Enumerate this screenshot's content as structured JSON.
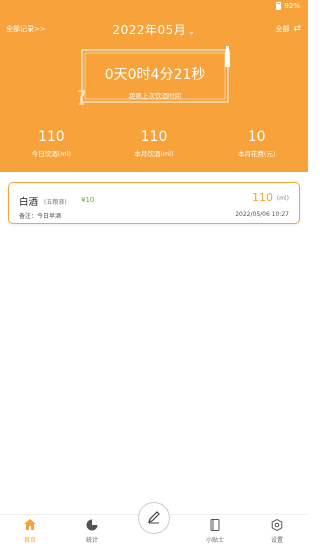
{
  "status_bar": {
    "battery": "92%"
  },
  "header": {
    "all_records_link": "全部记录>>",
    "month": "2022年05月",
    "filter_label": "全部",
    "timer_value": "0天0时4分21秒",
    "timer_label": "距离上次饮酒时间",
    "stats": [
      {
        "value": "110",
        "label": "今日饮酒(ml)"
      },
      {
        "value": "110",
        "label": "本月饮酒(ml)"
      },
      {
        "value": "10",
        "label": "本月花费(元)"
      }
    ]
  },
  "records": [
    {
      "name": "白酒",
      "tag": "(五粮液)",
      "price": "¥10",
      "note": "备注：今日早酒",
      "amount": "110",
      "unit": "(ml)",
      "time": "2022/05/06 10:27"
    }
  ],
  "nav": {
    "home": "首页",
    "stats": "统计",
    "tips": "小贴士",
    "settings": "设置"
  },
  "colors": {
    "accent": "#f7a23a",
    "price": "#58b33c"
  }
}
